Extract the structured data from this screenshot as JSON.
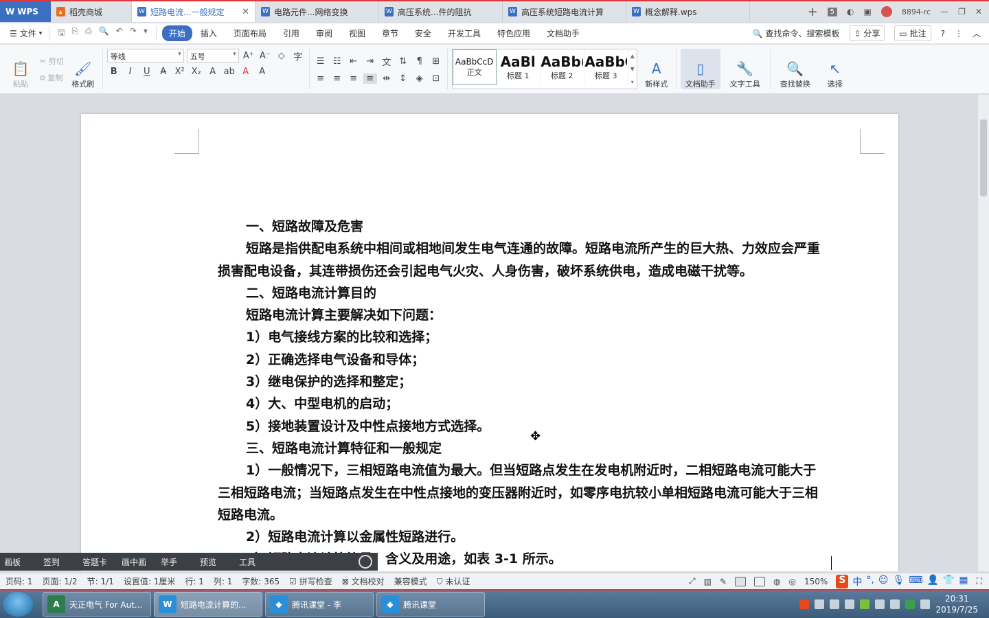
{
  "tabbar": {
    "app": "WPS",
    "tabs": [
      {
        "label": "稻壳商城",
        "active": false
      },
      {
        "label": "短路电流...一般规定",
        "active": true
      },
      {
        "label": "电路元件...网络变换",
        "active": false
      },
      {
        "label": "高压系统...件的阻抗",
        "active": false
      },
      {
        "label": "高压系统短路电流计算",
        "active": false
      },
      {
        "label": "概念解释.wps",
        "active": false
      }
    ],
    "tab_count": "5",
    "user": "8894-rc"
  },
  "menubar": {
    "file": "文件",
    "items": [
      "开始",
      "插入",
      "页面布局",
      "引用",
      "审阅",
      "视图",
      "章节",
      "安全",
      "开发工具",
      "特色应用",
      "文档助手"
    ],
    "search": "查找命令、搜索模板",
    "share": "分享",
    "comment": "批注"
  },
  "ribbon": {
    "paste": "粘贴",
    "cut": "剪切",
    "copy": "复制",
    "format_painter": "格式刷",
    "font_name": "等线",
    "font_size": "五号",
    "styles": [
      {
        "sample": "AaBbCcD",
        "caption": "正文"
      },
      {
        "sample": "AaBl",
        "caption": "标题 1"
      },
      {
        "sample": "AaBb(",
        "caption": "标题 2"
      },
      {
        "sample": "AaBbC",
        "caption": "标题 3"
      }
    ],
    "new_style": "新样式",
    "doc_helper": "文档助手",
    "text_tools": "文字工具",
    "find_replace": "查找替换",
    "select": "选择"
  },
  "document": {
    "lines": [
      {
        "cls": "h",
        "text": "一、短路故障及危害"
      },
      {
        "cls": "ind",
        "text": "短路是指供配电系统中相间或相地间发生电气连通的故障。短路电流所产生的巨大热、力效应会严重损害配电设备，其连带损伤还会引起电气火灾、人身伤害，破坏系统供电，造成电磁干扰等。"
      },
      {
        "cls": "h",
        "text": "二、短路电流计算目的"
      },
      {
        "cls": "li",
        "text": "短路电流计算主要解决如下问题："
      },
      {
        "cls": "li",
        "text": "1）电气接线方案的比较和选择；"
      },
      {
        "cls": "li",
        "text": "2）正确选择电气设备和导体；"
      },
      {
        "cls": "li",
        "text": "3）继电保护的选择和整定；"
      },
      {
        "cls": "li",
        "text": "4）大、中型电机的启动；"
      },
      {
        "cls": "li",
        "text": "5）接地装置设计及中性点接地方式选择。"
      },
      {
        "cls": "h",
        "text": "三、短路电流计算特征和一般规定"
      },
      {
        "cls": "ind",
        "text": "1）一般情况下，三相短路电流值为最大。但当短路点发生在发电机附近时，二相短路电流可能大于三相短路电流；当短路点发生在中性点接地的变压器附近时，如零序电抗较小单相短路电流可能大于三相短路电流。"
      },
      {
        "cls": "li",
        "text": "2）短路电流计算以金属性短路进行。"
      },
      {
        "cls": "li",
        "text": "3）短路电流计算符号、含义及用途，如表 3-1 所示。"
      }
    ]
  },
  "classbar": {
    "items": [
      "画板",
      "签到",
      "答题卡",
      "画中画",
      "举手",
      "预览",
      "工具"
    ]
  },
  "statusbar": {
    "page": "页码: 1",
    "pages": "页面: 1/2",
    "section": "节: 1/1",
    "setting": "设置值: 1厘米",
    "row": "行: 1",
    "col": "列: 1",
    "words": "字数: 365",
    "spell": "拼写检查",
    "proof": "文档校对",
    "compat": "兼容模式",
    "cert": "未认证",
    "zoom": "150%"
  },
  "taskbar": {
    "tasks": [
      {
        "label": "天正电气 For Aut...",
        "icon": "A"
      },
      {
        "label": "短路电流计算的...",
        "icon": "W"
      },
      {
        "label": "腾讯课堂 - 李",
        "icon": "◆"
      },
      {
        "label": "腾讯课堂",
        "icon": "◆"
      }
    ],
    "time": "20:31",
    "date": "2019/7/25"
  }
}
